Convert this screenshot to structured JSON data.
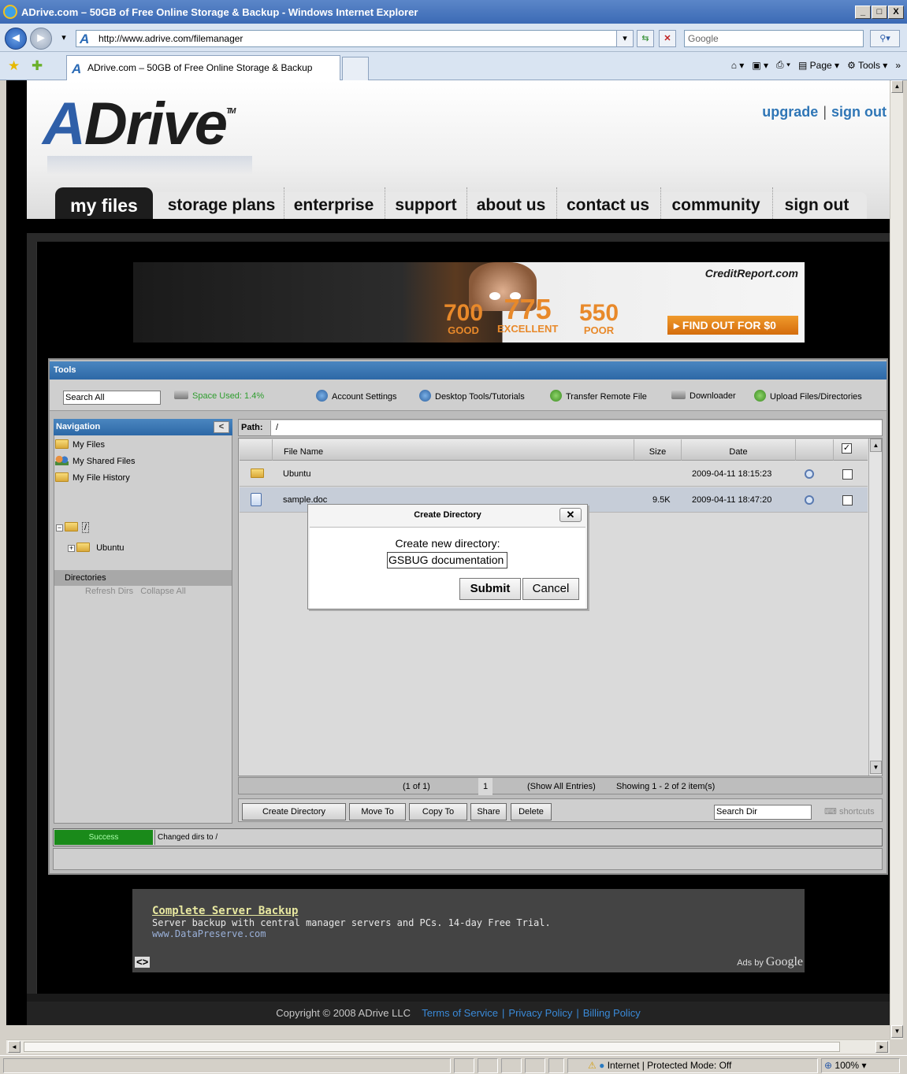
{
  "window": {
    "title": "ADrive.com – 50GB of Free Online Storage & Backup - Windows Internet Explorer",
    "min": "_",
    "max": "□",
    "close": "X"
  },
  "browser": {
    "url": "http://www.adrive.com/filemanager",
    "search_placeholder": "Google",
    "tab_title": "ADrive.com – 50GB of Free Online Storage & Backup",
    "commands": {
      "page": "Page",
      "tools": "Tools"
    },
    "status": {
      "zone": "Internet | Protected Mode: Off",
      "zoom": "100%"
    }
  },
  "site": {
    "logo_a": "A",
    "logo_rest": "Drive",
    "logo_tm": "TM",
    "header_links": [
      "upgrade",
      "sign out"
    ],
    "nav": [
      "my files",
      "storage plans",
      "enterprise",
      "support",
      "about us",
      "contact us",
      "community",
      "sign out"
    ]
  },
  "banner": {
    "brand": "CreditReport.com",
    "scores": [
      {
        "n": "700",
        "l": "GOOD"
      },
      {
        "n": "775",
        "l": "EXCELLENT"
      },
      {
        "n": "550",
        "l": "POOR"
      }
    ],
    "cta": "▸ FIND OUT FOR $0"
  },
  "tools": {
    "title": "Tools",
    "search_all": "Search All",
    "space_used": "Space Used: 1.4%",
    "items": [
      "Account Settings",
      "Desktop Tools/Tutorials",
      "Transfer Remote File",
      "Downloader",
      "Upload Files/Directories"
    ]
  },
  "navigation": {
    "title": "Navigation",
    "links": [
      "My Files",
      "My Shared Files",
      "My File History"
    ],
    "directories_label": "Directories",
    "refresh": "Refresh Dirs",
    "collapse": "Collapse All",
    "tree": {
      "root": "/",
      "child": "Ubuntu"
    }
  },
  "path": {
    "label": "Path:",
    "value": "/"
  },
  "grid": {
    "columns": {
      "name": "File Name",
      "size": "Size",
      "date": "Date"
    },
    "rows": [
      {
        "type": "folder",
        "name": "Ubuntu",
        "size": "",
        "date": "2009-04-11 18:15:23"
      },
      {
        "type": "doc",
        "name": "sample.doc",
        "size": "9.5K",
        "date": "2009-04-11 18:47:20"
      }
    ]
  },
  "pager": {
    "pages": "(1 of 1)",
    "current": "1",
    "show_all": "(Show All Entries)",
    "showing": "Showing 1 - 2 of 2 item(s)"
  },
  "actions": [
    "Create Directory",
    "Move To",
    "Copy To",
    "Share",
    "Delete"
  ],
  "search_dir": "Search Dir",
  "shortcuts": "shortcuts",
  "status": {
    "state": "Success",
    "message": "Changed dirs to /"
  },
  "modal": {
    "title": "Create Directory",
    "label": "Create new directory:",
    "value": "GSBUG documentation",
    "submit": "Submit",
    "cancel": "Cancel"
  },
  "ad": {
    "title": "Complete Server Backup",
    "desc": "Server backup with central manager servers and PCs. 14-day Free Trial.",
    "url": "www.DataPreserve.com",
    "nav": "<>",
    "ads_by": "Ads by",
    "google": "Google"
  },
  "footer": {
    "copyright": "Copyright © 2008 ADrive LLC",
    "links": [
      "Terms of Service",
      "Privacy Policy",
      "Billing Policy"
    ]
  }
}
